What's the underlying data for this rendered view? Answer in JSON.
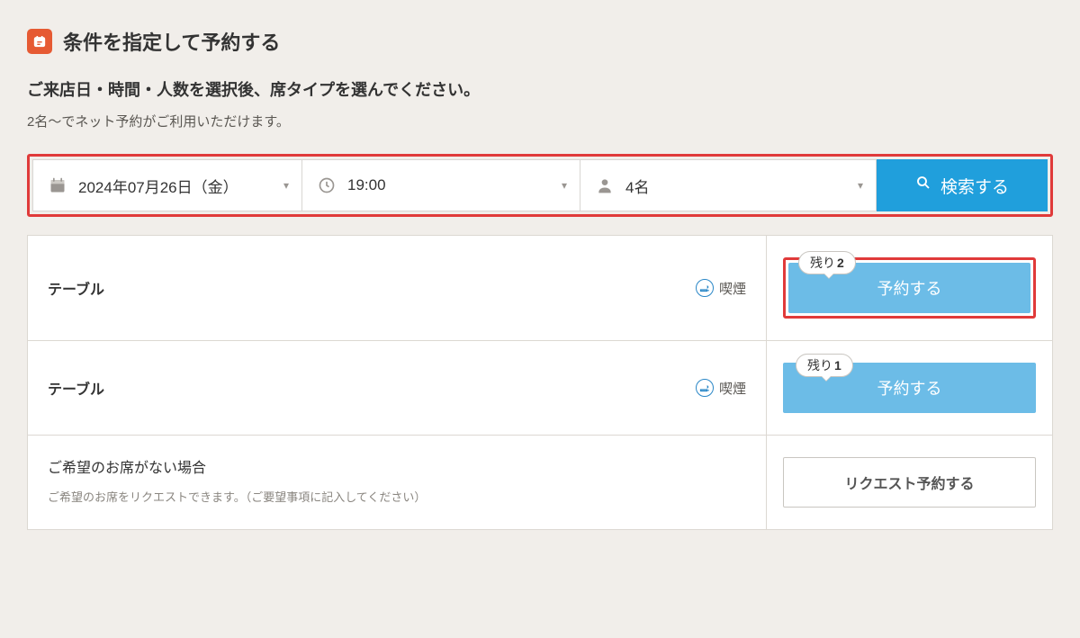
{
  "section": {
    "title": "条件を指定して予約する"
  },
  "instructions": {
    "title": "ご来店日・時間・人数を選択後、席タイプを選んでください。",
    "note": "2名～でネット予約がご利用いただけます。"
  },
  "search": {
    "date": "2024年07月26日（金）",
    "time": "19:00",
    "party": "4名",
    "button": "検索する"
  },
  "results": [
    {
      "seat": "テーブル",
      "smoking_label": "喫煙",
      "remaining_prefix": "残り",
      "remaining": "2",
      "button": "予約する",
      "highlight": true
    },
    {
      "seat": "テーブル",
      "smoking_label": "喫煙",
      "remaining_prefix": "残り",
      "remaining": "1",
      "button": "予約する",
      "highlight": false
    }
  ],
  "request": {
    "title": "ご希望のお席がない場合",
    "note": "ご希望のお席をリクエストできます。（ご要望事項に記入してください）",
    "button": "リクエスト予約する"
  }
}
